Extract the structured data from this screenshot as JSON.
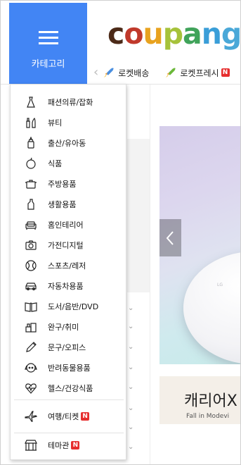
{
  "header": {
    "category_label": "카테고리",
    "logo_letters": [
      {
        "ch": "c",
        "color": "#4c2a18"
      },
      {
        "ch": "o",
        "color": "#c0392b"
      },
      {
        "ch": "u",
        "color": "#e8a21f"
      },
      {
        "ch": "p",
        "color": "#a6c23a"
      },
      {
        "ch": "a",
        "color": "#40a35a"
      },
      {
        "ch": "n",
        "color": "#3a9ed8"
      },
      {
        "ch": "g",
        "color": "#4aa8d8"
      }
    ],
    "rocket_links": [
      {
        "label": "로켓배송",
        "badge": ""
      },
      {
        "label": "로켓프레시",
        "badge": "N"
      }
    ]
  },
  "menu": {
    "items": [
      {
        "icon": "dress-icon",
        "label": "패션의류/잡화"
      },
      {
        "icon": "beauty-icon",
        "label": "뷰티"
      },
      {
        "icon": "baby-bottle-icon",
        "label": "출산/유아동"
      },
      {
        "icon": "apple-icon",
        "label": "식품"
      },
      {
        "icon": "pot-icon",
        "label": "주방용품"
      },
      {
        "icon": "detergent-icon",
        "label": "생활용품"
      },
      {
        "icon": "sofa-icon",
        "label": "홈인테리어"
      },
      {
        "icon": "camera-icon",
        "label": "가전디지털"
      },
      {
        "icon": "ball-icon",
        "label": "스포츠/레저"
      },
      {
        "icon": "car-icon",
        "label": "자동차용품"
      },
      {
        "icon": "book-icon",
        "label": "도서/음반/DVD"
      },
      {
        "icon": "toy-icon",
        "label": "완구/취미"
      },
      {
        "icon": "pencil-icon",
        "label": "문구/오피스"
      },
      {
        "icon": "dog-icon",
        "label": "반려동물용품"
      },
      {
        "icon": "heart-pulse-icon",
        "label": "헬스/건강식품"
      }
    ],
    "extra_items": [
      {
        "icon": "airplane-icon",
        "label": "여행/티켓",
        "badge": "N"
      },
      {
        "icon": "themed-store-icon",
        "label": "테마관",
        "badge": "N"
      }
    ]
  },
  "banner": {
    "product_mark": "LG"
  },
  "promo": {
    "title": "캐리어X",
    "subtitle": "Fall in Modevi"
  },
  "colors": {
    "category_button": "#4285f4",
    "badge": "#e62e2e"
  }
}
